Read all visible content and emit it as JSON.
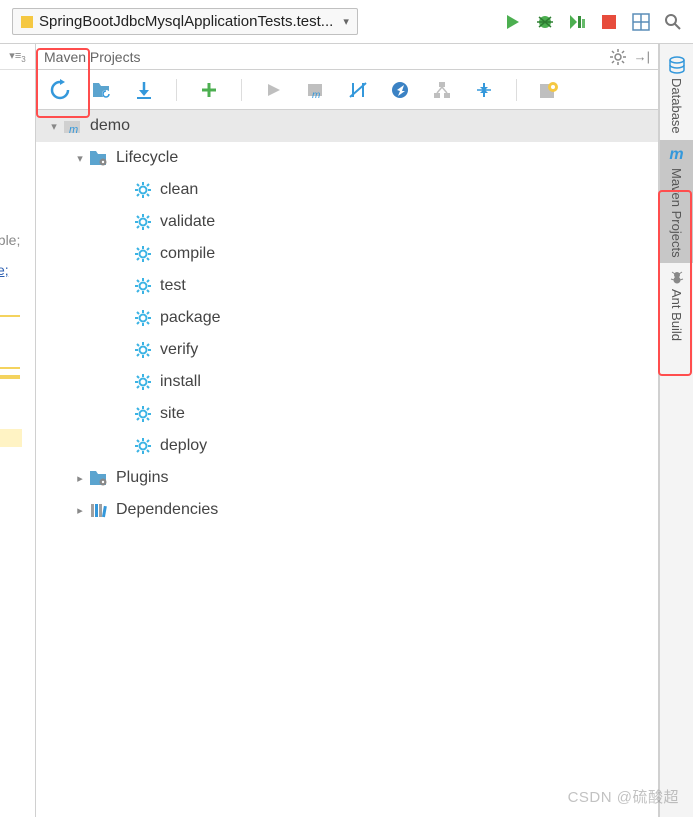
{
  "topbar": {
    "run_config_label": "SpringBootJdbcMysqlApplicationTests.test..."
  },
  "left": {
    "tab": "▾≡",
    "code_frag_1": "able;",
    "code_frag_2": "ce;"
  },
  "panel": {
    "title": "Maven Projects"
  },
  "tree": {
    "root": {
      "label": "demo"
    },
    "lifecycle": {
      "label": "Lifecycle",
      "items": [
        "clean",
        "validate",
        "compile",
        "test",
        "package",
        "verify",
        "install",
        "site",
        "deploy"
      ]
    },
    "plugins": {
      "label": "Plugins"
    },
    "dependencies": {
      "label": "Dependencies"
    }
  },
  "rail": {
    "database": "Database",
    "maven": "Maven Projects",
    "ant": "Ant Build"
  },
  "watermark": "CSDN @硫酸超"
}
